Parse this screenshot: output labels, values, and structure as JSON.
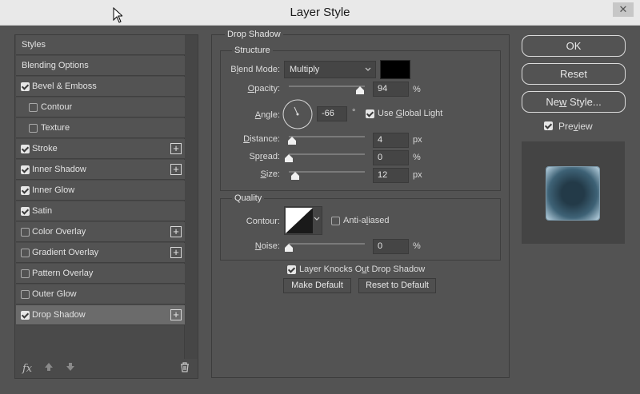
{
  "window": {
    "title": "Layer Style",
    "close_glyph": "✕"
  },
  "styles_list": [
    {
      "label": "Styles",
      "kind": "plain"
    },
    {
      "label": "Blending Options",
      "kind": "plain"
    },
    {
      "label": "Bevel & Emboss",
      "kind": "check",
      "checked": true,
      "plus": false
    },
    {
      "label": "Contour",
      "kind": "sub",
      "checked": false
    },
    {
      "label": "Texture",
      "kind": "sub",
      "checked": false
    },
    {
      "label": "Stroke",
      "kind": "check",
      "checked": true,
      "plus": true
    },
    {
      "label": "Inner Shadow",
      "kind": "check",
      "checked": true,
      "plus": true
    },
    {
      "label": "Inner Glow",
      "kind": "check",
      "checked": true,
      "plus": false
    },
    {
      "label": "Satin",
      "kind": "check",
      "checked": true,
      "plus": false
    },
    {
      "label": "Color Overlay",
      "kind": "check",
      "checked": false,
      "plus": true
    },
    {
      "label": "Gradient Overlay",
      "kind": "check",
      "checked": false,
      "plus": true
    },
    {
      "label": "Pattern Overlay",
      "kind": "check",
      "checked": false,
      "plus": false
    },
    {
      "label": "Outer Glow",
      "kind": "check",
      "checked": false,
      "plus": false
    },
    {
      "label": "Drop Shadow",
      "kind": "check",
      "checked": true,
      "plus": true,
      "selected": true
    }
  ],
  "list_footer": {
    "fx": "fx"
  },
  "drop_shadow": {
    "section_title": "Drop Shadow",
    "structure": {
      "title": "Structure",
      "blend_mode": {
        "label_pre": "B",
        "label_u": "l",
        "label_post": "end Mode:",
        "value": "Multiply",
        "color": "#000000"
      },
      "opacity": {
        "label_pre": "",
        "label_u": "O",
        "label_post": "pacity:",
        "value": "94",
        "unit": "%",
        "level": 0.94
      },
      "angle": {
        "label_pre": "",
        "label_u": "A",
        "label_post": "ngle:",
        "value": "-66",
        "unit": "°",
        "global_light_pre": "Use ",
        "global_light_u": "G",
        "global_light_post": "lobal Light",
        "global_light_checked": true
      },
      "distance": {
        "label_pre": "",
        "label_u": "D",
        "label_post": "istance:",
        "value": "4",
        "unit": "px",
        "level": 0.04
      },
      "spread": {
        "label_pre": "Sp",
        "label_u": "r",
        "label_post": "ead:",
        "value": "0",
        "unit": "%",
        "level": 0.0
      },
      "size": {
        "label_pre": "",
        "label_u": "S",
        "label_post": "ize:",
        "value": "12",
        "unit": "px",
        "level": 0.08
      }
    },
    "quality": {
      "title": "Quality",
      "contour_label": "Contour:",
      "anti_aliased_pre": "Anti-a",
      "anti_aliased_u": "l",
      "anti_aliased_post": "iased",
      "anti_aliased_checked": false,
      "noise": {
        "label_pre": "",
        "label_u": "N",
        "label_post": "oise:",
        "value": "0",
        "unit": "%",
        "level": 0.0
      }
    },
    "knockout_pre": "Layer Knocks O",
    "knockout_u": "u",
    "knockout_post": "t Drop Shadow",
    "knockout_checked": true,
    "make_default": "Make Default",
    "reset_default": "Reset to Default"
  },
  "buttons": {
    "ok": "OK",
    "reset": "Reset",
    "new_style_pre": "Ne",
    "new_style_u": "w",
    "new_style_post": " Style...",
    "preview_pre": "Pre",
    "preview_u": "v",
    "preview_post": "iew",
    "preview_checked": true
  }
}
